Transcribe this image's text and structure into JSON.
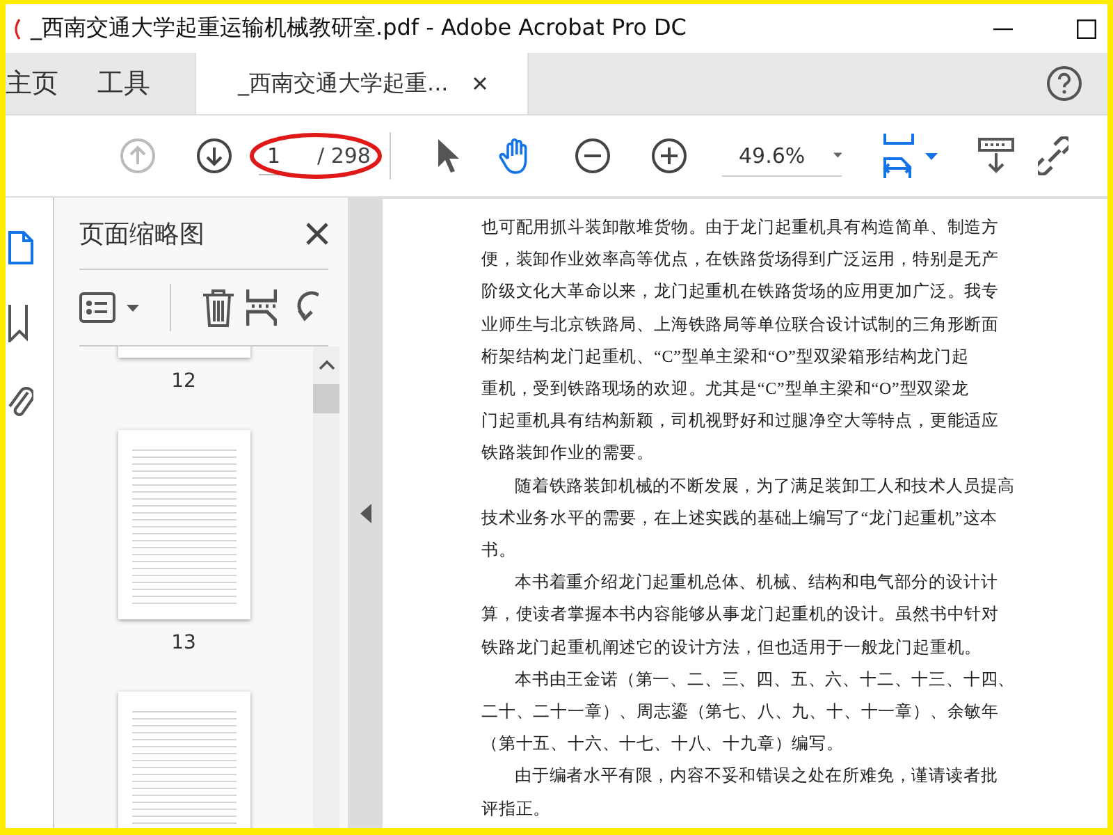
{
  "window": {
    "title": "_西南交通大学起重运输机械教研室.pdf - Adobe Acrobat Pro DC"
  },
  "tabs": [
    {
      "label": "主页",
      "selected": false
    },
    {
      "label": "工具",
      "selected": false
    },
    {
      "label": "_西南交通大学起重...",
      "selected": true
    }
  ],
  "toolbar": {
    "previous_page_disabled": true,
    "page_number": "1",
    "page_count": "/ 298",
    "page_field_circled": true,
    "zoom": "49.6%"
  },
  "sidebar": {
    "title": "页面缩略图",
    "thumbnails": [
      {
        "label": "12"
      },
      {
        "label": "13"
      }
    ]
  },
  "document": {
    "paragraphs": [
      {
        "indent": false,
        "lines": [
          "也可配用抓斗装卸散堆货物。由于龙门起重机具有构造简单、制造方",
          "便，装卸作业效率高等优点，在铁路货场得到广泛运用，特别是无产",
          "阶级文化大革命以来，龙门起重机在铁路货场的应用更加广泛。我专",
          "业师生与北京铁路局、上海铁路局等单位联合设计试制的三角形断面",
          "桁架结构龙门起重机、“C”型单主梁和“O”型双梁箱形结构龙门起",
          "重机，受到铁路现场的欢迎。尤其是“C”型单主梁和“O”型双梁龙",
          "门起重机具有结构新颖，司机视野好和过腿净空大等特点，更能适应",
          "铁路装卸作业的需要。"
        ]
      },
      {
        "indent": true,
        "lines": [
          "随着铁路装卸机械的不断发展，为了满足装卸工人和技术人员提高",
          "技术业务水平的需要，在上述实践的基础上编写了“龙门起重机”这本",
          "书。"
        ]
      },
      {
        "indent": true,
        "lines": [
          "本书着重介绍龙门起重机总体、机械、结构和电气部分的设计计",
          "算，使读者掌握本书内容能够从事龙门起重机的设计。虽然书中针对",
          "铁路龙门起重机阐述它的设计方法，但也适用于一般龙门起重机。"
        ]
      },
      {
        "indent": true,
        "lines": [
          "本书由王金诺（第一、二、三、四、五、六、十二、十三、十四、",
          "二十、二十一章）、周志鎏（第七、八、九、十、十一章）、余敏年",
          "（第十五、十六、十七、十八、十九章）编写。"
        ]
      },
      {
        "indent": true,
        "lines": [
          "由于编者水平有限，内容不妥和错误之处在所难免，谨请读者批",
          "评指正。"
        ]
      }
    ]
  }
}
